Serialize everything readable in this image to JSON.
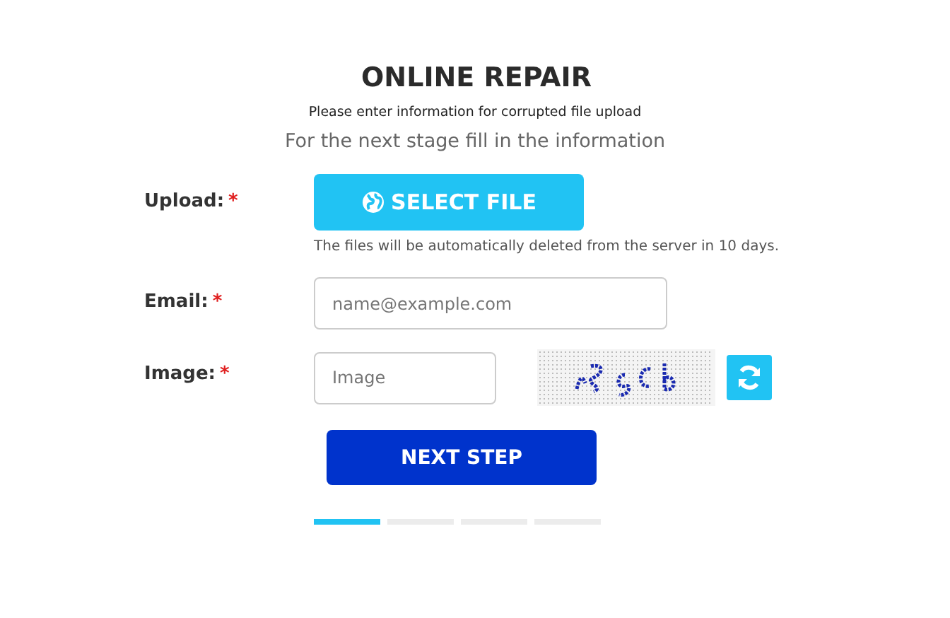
{
  "title": "ONLINE REPAIR",
  "subtitle": "Please enter information for corrupted file upload",
  "stage_note": "For the next stage fill in the information",
  "fields": [
    {
      "kind": "upload",
      "label": "Upload:",
      "required": true,
      "required_mark": "*",
      "button": "SELECT FILE",
      "hint": "The files will be automatically deleted from the server in 10 days."
    },
    {
      "kind": "text",
      "label": "Email:",
      "required": true,
      "required_mark": "*",
      "placeholder": "name@example.com"
    },
    {
      "kind": "captcha",
      "label": "Image:",
      "required": true,
      "required_mark": "*",
      "placeholder": "Image"
    }
  ],
  "submit": "NEXT STEP",
  "steps": [
    {
      "selected": true
    },
    {
      "selected": false
    },
    {
      "selected": false
    },
    {
      "selected": false
    }
  ]
}
